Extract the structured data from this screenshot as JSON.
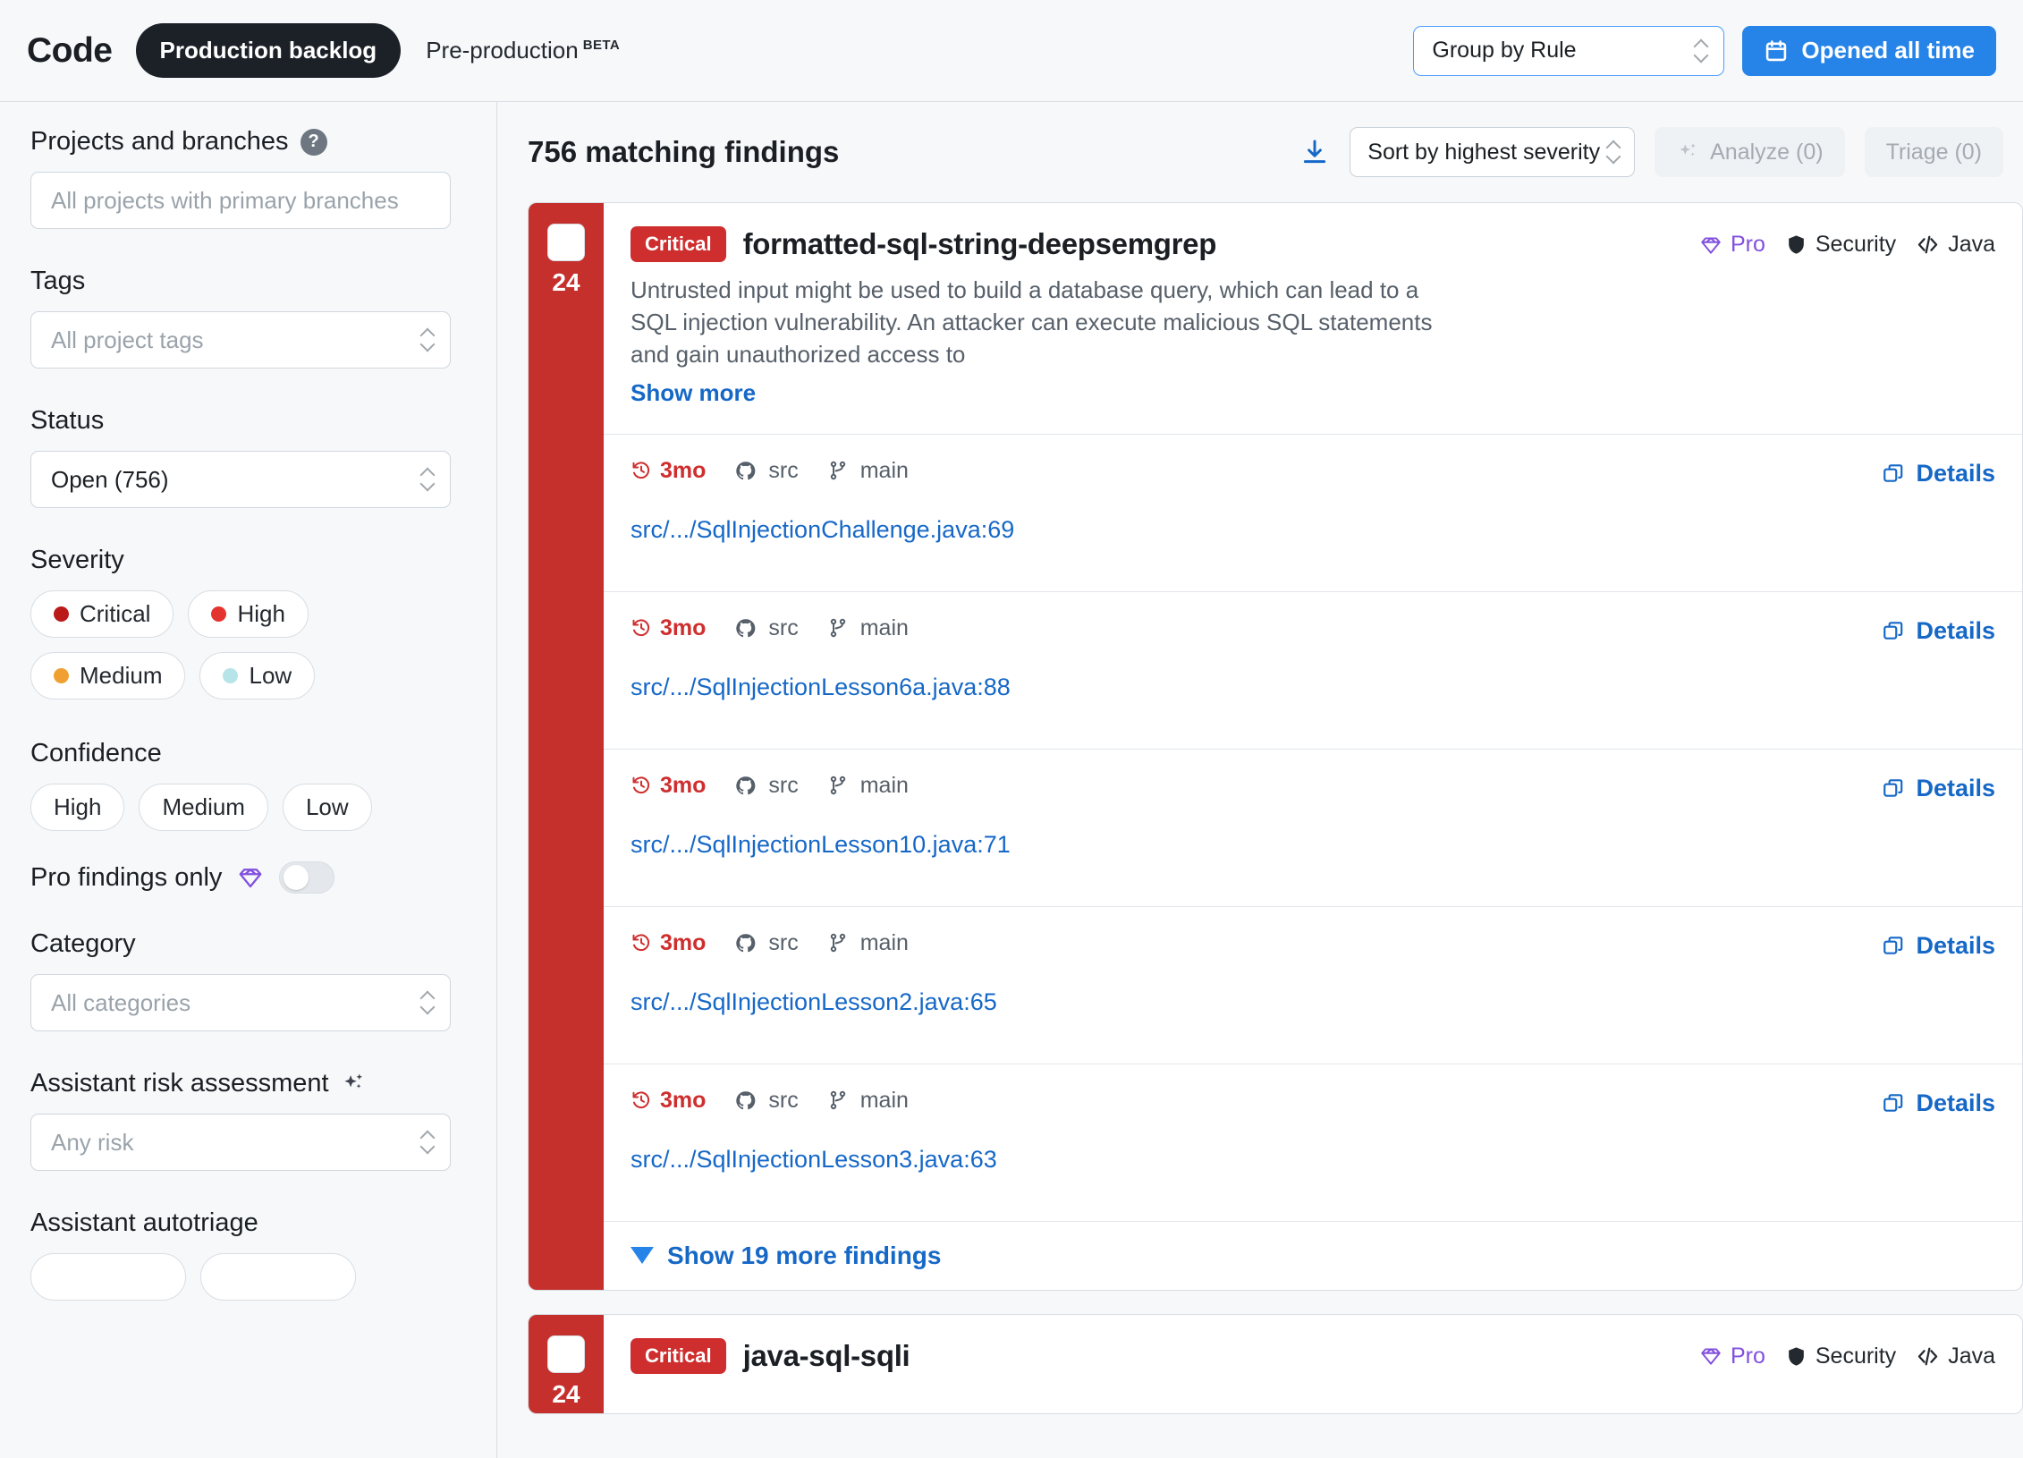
{
  "header": {
    "brand": "Code",
    "context_pill": "Production backlog",
    "environment": "Pre-production",
    "environment_tag": "BETA",
    "group_by": {
      "label": "Group by Rule",
      "icon": "chevron-updown-icon"
    },
    "date_button": {
      "label": "Opened all time",
      "icon": "calendar-icon",
      "color": "#2684e8"
    }
  },
  "sidebar": {
    "projects": {
      "label": "Projects and branches",
      "help_icon": "question-mark-icon",
      "placeholder": "All projects with primary branches"
    },
    "tags": {
      "label": "Tags",
      "placeholder": "All project tags"
    },
    "status": {
      "label": "Status",
      "value": "Open (756)"
    },
    "severity": {
      "label": "Severity",
      "options": [
        {
          "label": "Critical",
          "color": "#bb1a1a"
        },
        {
          "label": "High",
          "color": "#e3342f"
        },
        {
          "label": "Medium",
          "color": "#f0a030"
        },
        {
          "label": "Low",
          "color": "#b7e4e8"
        }
      ]
    },
    "confidence": {
      "label": "Confidence",
      "options": [
        "High",
        "Medium",
        "Low"
      ]
    },
    "pro_only": {
      "label": "Pro findings only",
      "icon": "diamond-icon",
      "enabled": false
    },
    "category": {
      "label": "Category",
      "placeholder": "All categories"
    },
    "risk": {
      "label": "Assistant risk assessment",
      "icon": "sparkles-icon",
      "placeholder": "Any risk"
    },
    "autotriage": {
      "label": "Assistant autotriage"
    }
  },
  "main": {
    "count_label": "756 matching findings",
    "download_icon": "download-icon",
    "sort": {
      "label": "Sort by highest severity"
    },
    "analyze_button": {
      "label": "Analyze (0)",
      "icon": "sparkles-icon"
    },
    "triage_button": {
      "label": "Triage (0)"
    },
    "details_label": "Details",
    "details_icon": "open-panel-icon",
    "cards": [
      {
        "severity": "Critical",
        "count": "24",
        "rule_name": "formatted-sql-string-deepsemgrep",
        "description": "Untrusted input might be used to build a database query, which can lead to a SQL injection vulnerability. An attacker can execute malicious SQL statements and gain unauthorized access to",
        "show_more": "Show more",
        "tags": [
          {
            "label": "Pro",
            "icon": "diamond-icon",
            "accent": "#8250df"
          },
          {
            "label": "Security",
            "icon": "shield-icon",
            "accent": "#24292f"
          },
          {
            "label": "Java",
            "icon": "code-icon",
            "accent": "#24292f"
          }
        ],
        "findings": [
          {
            "age": "3mo",
            "repo": "src",
            "branch": "main",
            "path": "src/.../SqlInjectionChallenge.java:69"
          },
          {
            "age": "3mo",
            "repo": "src",
            "branch": "main",
            "path": "src/.../SqlInjectionLesson6a.java:88"
          },
          {
            "age": "3mo",
            "repo": "src",
            "branch": "main",
            "path": "src/.../SqlInjectionLesson10.java:71"
          },
          {
            "age": "3mo",
            "repo": "src",
            "branch": "main",
            "path": "src/.../SqlInjectionLesson2.java:65"
          },
          {
            "age": "3mo",
            "repo": "src",
            "branch": "main",
            "path": "src/.../SqlInjectionLesson3.java:63"
          }
        ],
        "show_more_findings": "Show 19 more findings"
      },
      {
        "severity": "Critical",
        "count": "24",
        "rule_name": "java-sql-sqli",
        "tags": [
          {
            "label": "Pro",
            "icon": "diamond-icon",
            "accent": "#8250df"
          },
          {
            "label": "Security",
            "icon": "shield-icon",
            "accent": "#24292f"
          },
          {
            "label": "Java",
            "icon": "code-icon",
            "accent": "#24292f"
          }
        ]
      }
    ]
  }
}
